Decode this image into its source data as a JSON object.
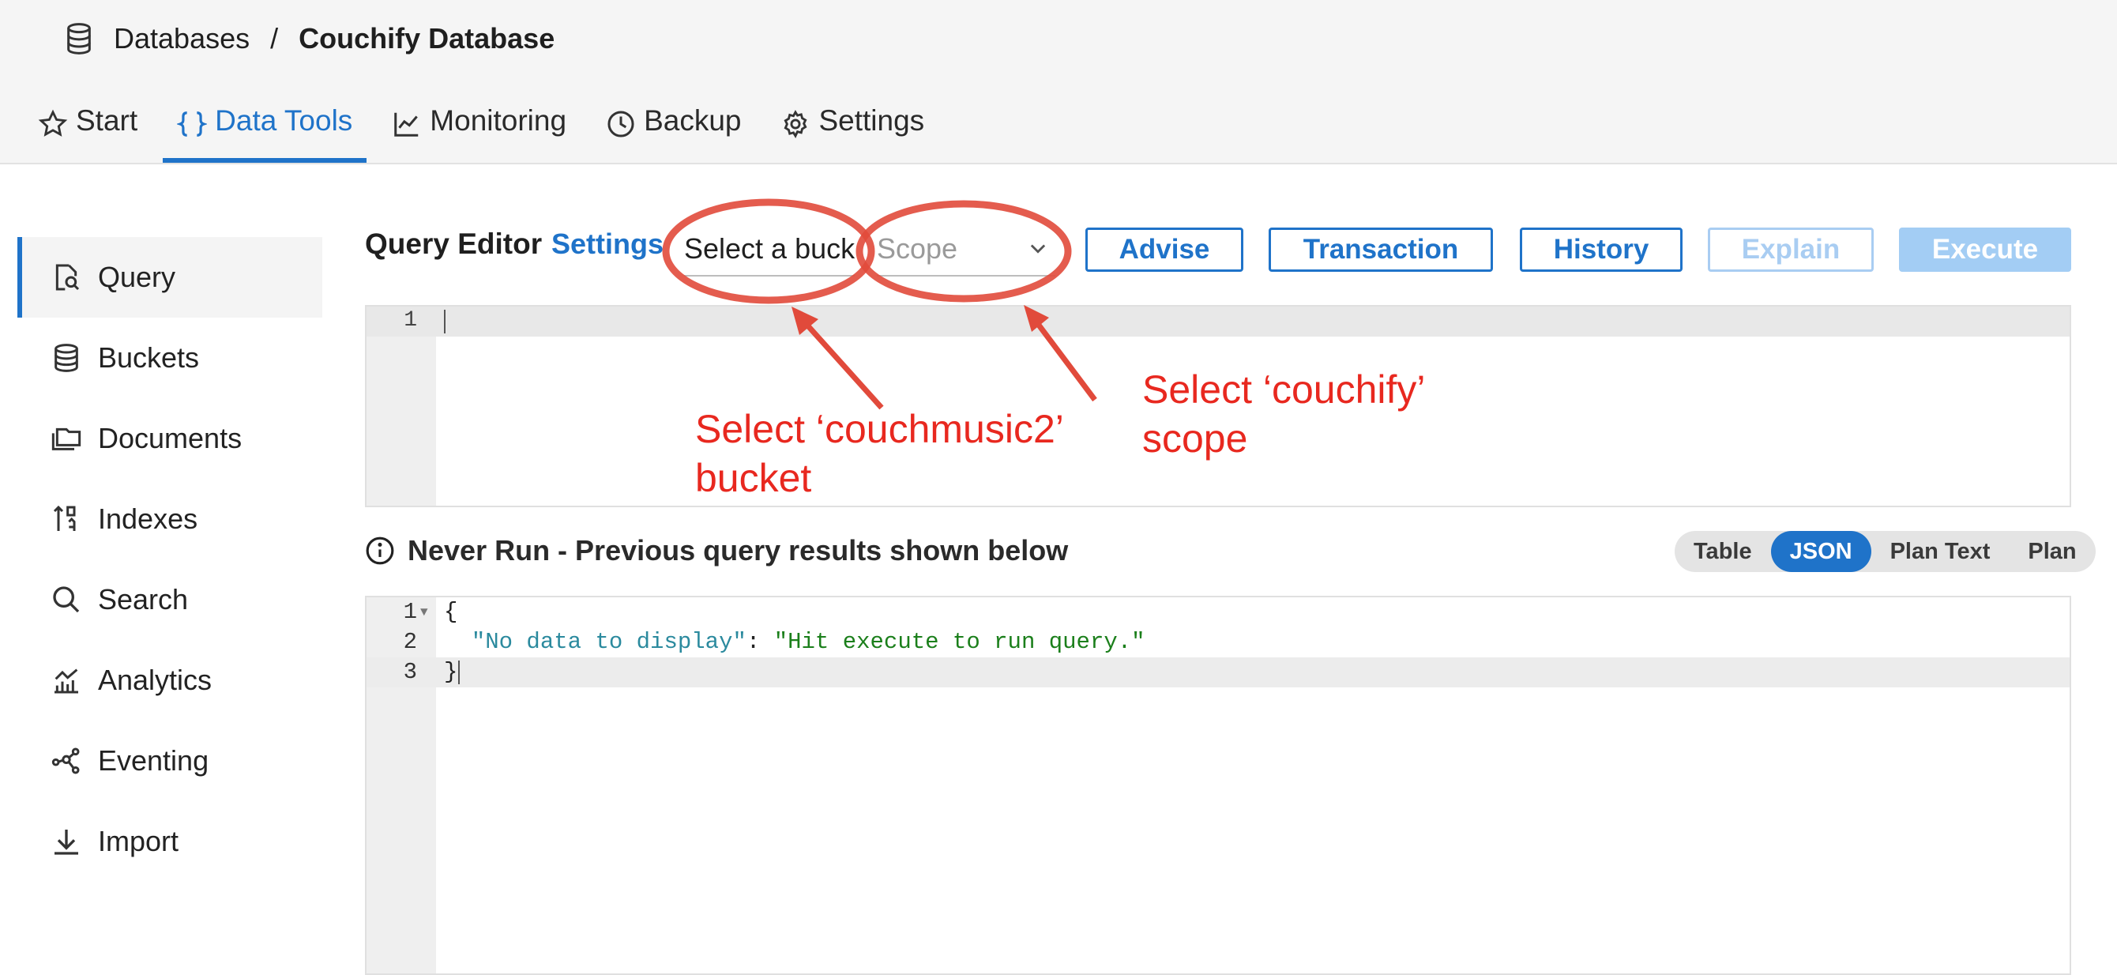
{
  "breadcrumb": {
    "root": "Databases",
    "separator": "/",
    "current": "Couchify Database"
  },
  "tabs": [
    {
      "label": "Start",
      "icon": "star-icon",
      "active": false
    },
    {
      "label": "Data Tools",
      "icon": "braces-icon",
      "active": true
    },
    {
      "label": "Monitoring",
      "icon": "chart-line-icon",
      "active": false
    },
    {
      "label": "Backup",
      "icon": "clock-icon",
      "active": false
    },
    {
      "label": "Settings",
      "icon": "gear-icon",
      "active": false
    }
  ],
  "sidebar": {
    "items": [
      {
        "label": "Query",
        "icon": "query-icon",
        "active": true
      },
      {
        "label": "Buckets",
        "icon": "database-icon",
        "active": false
      },
      {
        "label": "Documents",
        "icon": "folders-icon",
        "active": false
      },
      {
        "label": "Indexes",
        "icon": "sort-icon",
        "active": false
      },
      {
        "label": "Search",
        "icon": "search-icon",
        "active": false
      },
      {
        "label": "Analytics",
        "icon": "analytics-icon",
        "active": false
      },
      {
        "label": "Eventing",
        "icon": "eventing-icon",
        "active": false
      },
      {
        "label": "Import",
        "icon": "download-icon",
        "active": false
      }
    ]
  },
  "query_editor": {
    "title": "Query Editor",
    "settings_link": "Settings",
    "bucket_select": "Select a bucket",
    "scope_placeholder": "Scope",
    "buttons": {
      "advise": "Advise",
      "transaction": "Transaction",
      "history": "History",
      "explain": "Explain",
      "execute": "Execute"
    },
    "editor_line_numbers": [
      "1"
    ]
  },
  "status": {
    "text": "Never Run - Previous query results shown below",
    "icon": "info-icon"
  },
  "view_toggle": {
    "options": [
      "Table",
      "JSON",
      "Plan Text",
      "Plan"
    ],
    "selected": "JSON"
  },
  "results": {
    "lines": [
      {
        "n": "1",
        "open": "{"
      },
      {
        "n": "2",
        "key": "\"No data to display\"",
        "colon": ": ",
        "value": "\"Hit execute to run query.\""
      },
      {
        "n": "3",
        "close": "}"
      }
    ]
  },
  "annotations": {
    "bucket_note": "Select ‘couchmusic2’\nbucket",
    "scope_note": "Select ‘couchify’\nscope"
  },
  "colors": {
    "accent": "#1f73c9",
    "annotation": "#e8281f",
    "execute_disabled": "#a3cdf4"
  }
}
